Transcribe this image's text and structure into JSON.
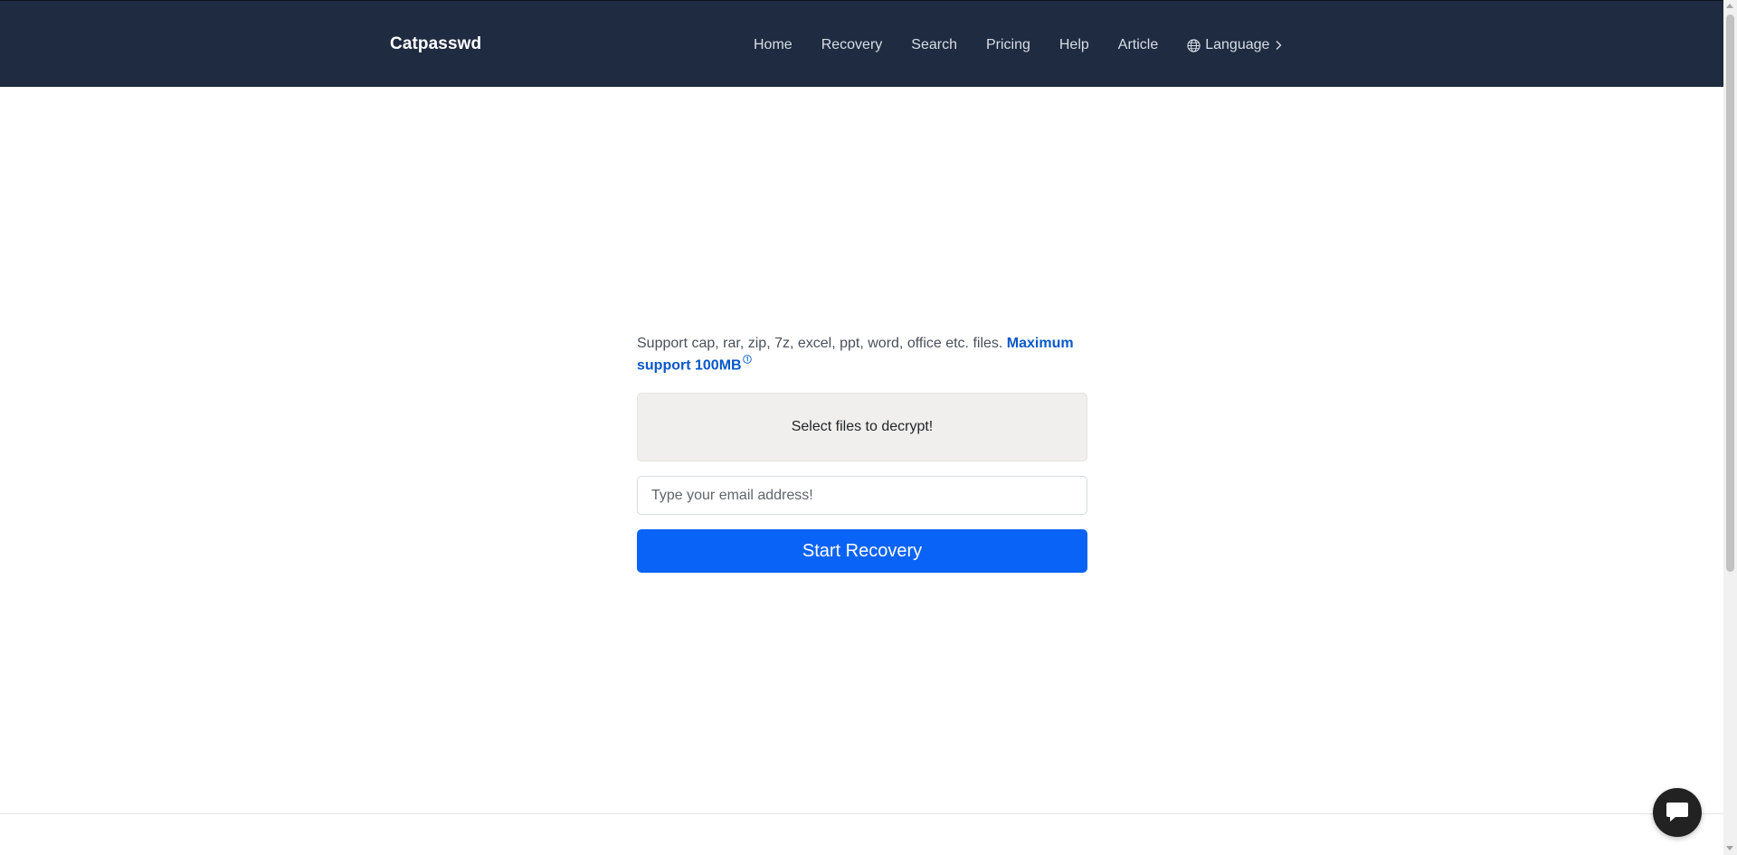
{
  "header": {
    "brand": "Catpasswd",
    "nav": {
      "home": "Home",
      "recovery": "Recovery",
      "search": "Search",
      "pricing": "Pricing",
      "help": "Help",
      "article": "Article",
      "language": "Language"
    },
    "language_icon": "globe-icon",
    "language_chevron_icon": "chevron-right-icon"
  },
  "main": {
    "support_text": "Support cap, rar, zip, 7z, excel, ppt, word, office etc. files.",
    "support_strong": "Maximum support 100MB",
    "support_icon": "info-icon",
    "file_select_label": "Select files to decrypt!",
    "email_placeholder": "Type your email address!",
    "email_value": "",
    "start_button_label": "Start Recovery"
  },
  "chat": {
    "icon": "chat-icon"
  },
  "colors": {
    "navbar_bg": "#1e2b40",
    "primary": "#0a63f7",
    "link_strong": "#0a58ca",
    "file_select_bg": "#f0efed"
  }
}
